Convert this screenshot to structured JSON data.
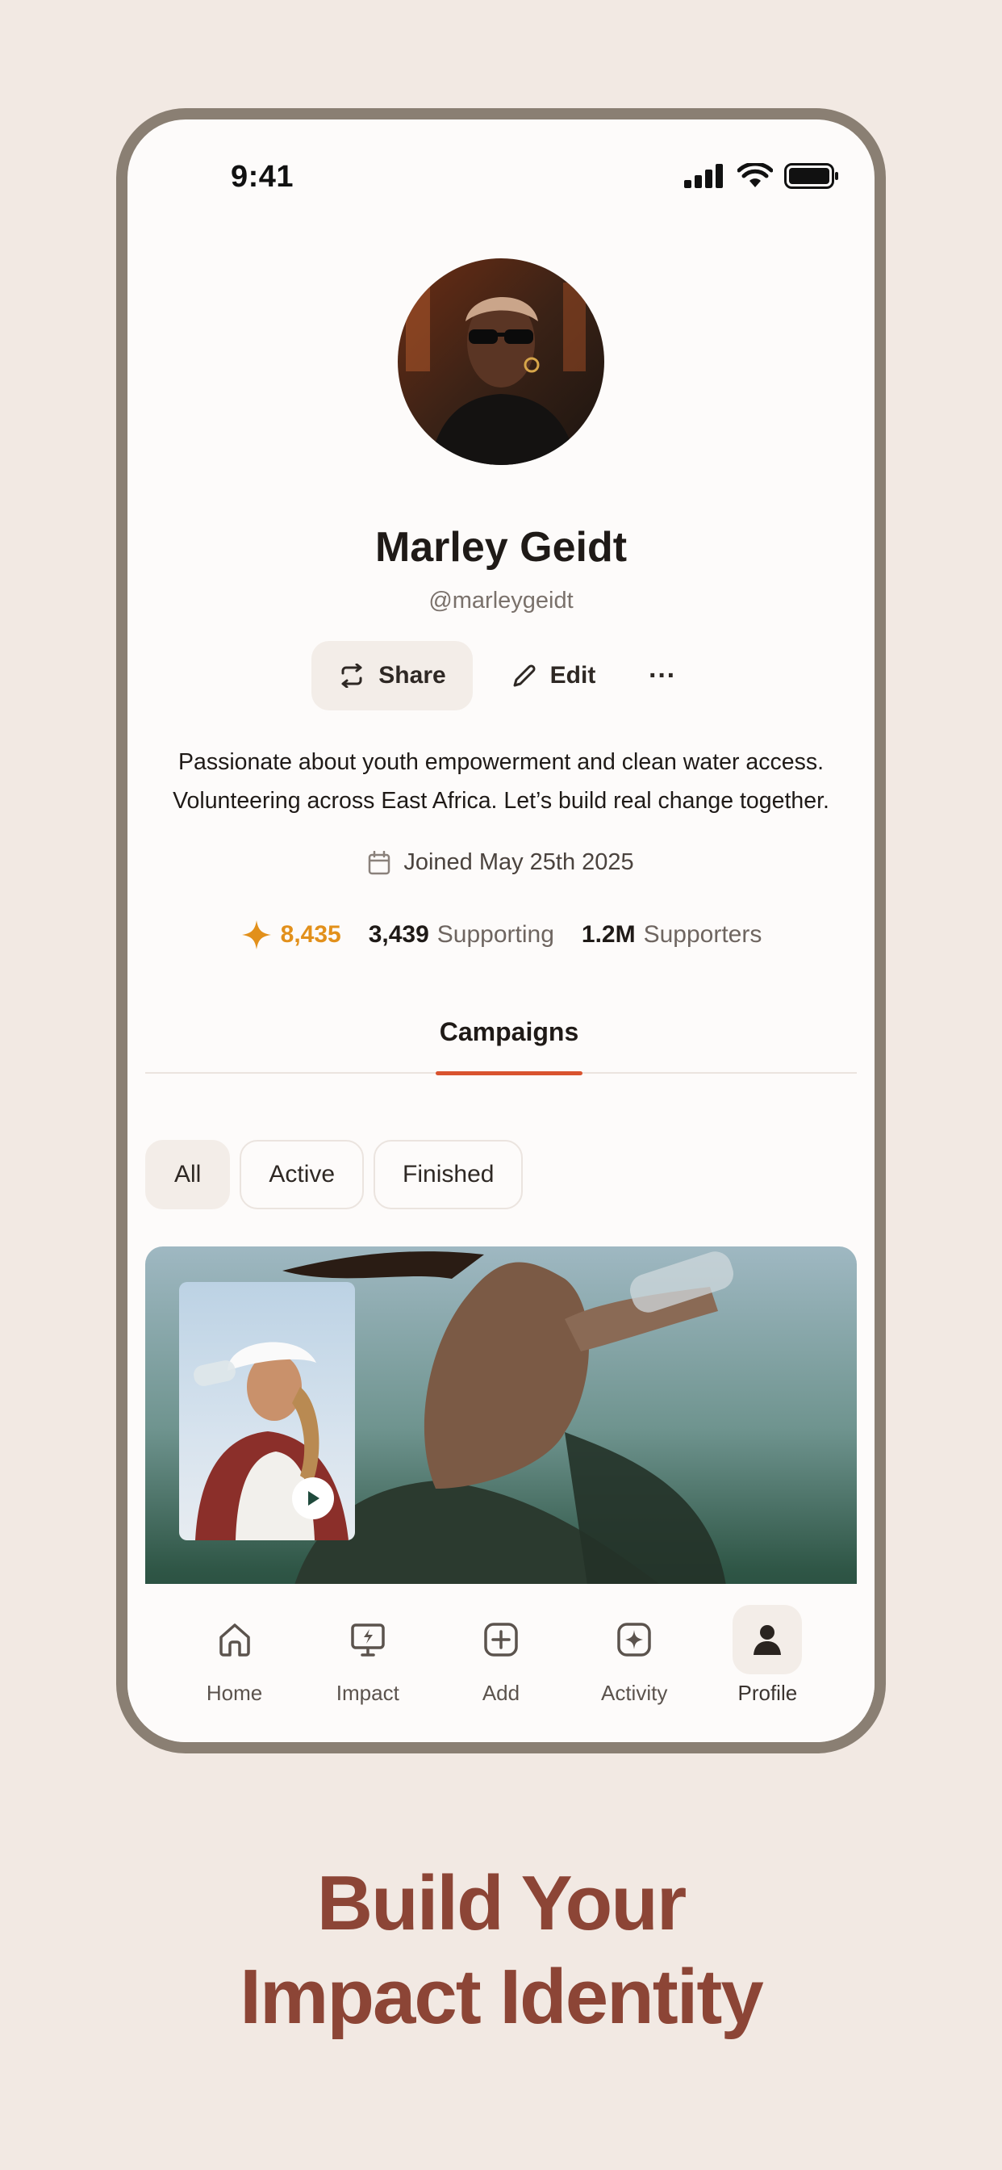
{
  "status_bar": {
    "time": "9:41"
  },
  "profile": {
    "name": "Marley Geidt",
    "handle": "@marleygeidt",
    "bio_line1": "Passionate about youth empowerment and clean water access.",
    "bio_line2": "Volunteering across East Africa. Let’s build real change together.",
    "joined": "Joined May 25th 2025"
  },
  "actions": {
    "share": "Share",
    "edit": "Edit",
    "more": "···"
  },
  "stats": {
    "sparkle_value": "8,435",
    "supporting_value": "3,439",
    "supporting_label": "Supporting",
    "supporters_value": "1.2M",
    "supporters_label": "Supporters"
  },
  "tabs": {
    "campaigns": "Campaigns"
  },
  "filters": [
    "All",
    "Active",
    "Finished"
  ],
  "nav": [
    {
      "label": "Home",
      "icon": "home-icon"
    },
    {
      "label": "Impact",
      "icon": "impact-icon"
    },
    {
      "label": "Add",
      "icon": "add-icon"
    },
    {
      "label": "Activity",
      "icon": "activity-icon"
    },
    {
      "label": "Profile",
      "icon": "profile-icon"
    }
  ],
  "headline": {
    "line1": "Build Your",
    "line2": "Impact Identity"
  },
  "colors": {
    "background": "#f2e9e3",
    "frame": "#8a7f73",
    "accent_tab": "#d9532f",
    "sparkle": "#e2901b",
    "headline": "#8c4536"
  }
}
